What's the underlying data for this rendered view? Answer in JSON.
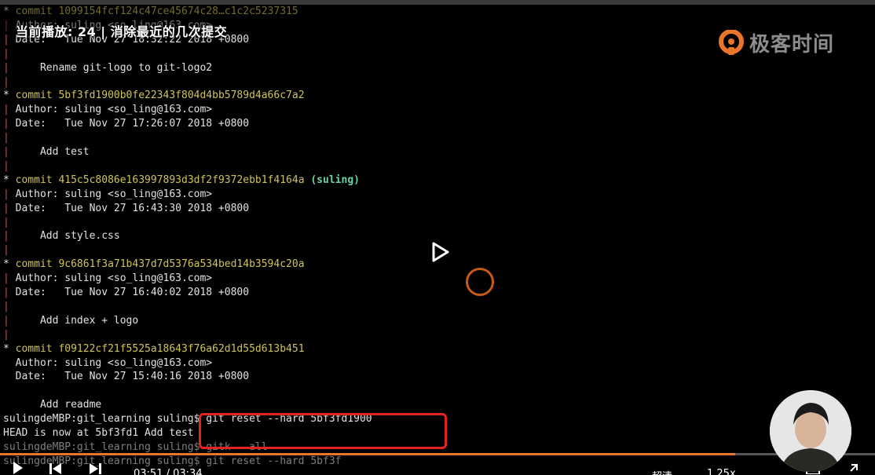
{
  "overlay": {
    "lesson_title": "当前播放: 24 | 消除最近的几次提交"
  },
  "brand": {
    "name": "极客时间",
    "logo_icon": "geektime-logo-icon",
    "logo_color": "#e8752a"
  },
  "terminal": {
    "lines": [
      {
        "graph": "*",
        "prefix": " commit ",
        "hash": "1099154fcf124c47ce45674c28…c1c2c5237315",
        "dim": true
      },
      {
        "graph": "|",
        "text": " Author: suling <so_ling@163.com>",
        "dim": true
      },
      {
        "graph": "|",
        "text": " Date:   Tue Nov 27 18:32:22 2018 +0800"
      },
      {
        "graph": "|",
        "text": ""
      },
      {
        "graph": "|",
        "text": "     Rename git-logo to git-logo2"
      },
      {
        "graph": "|",
        "text": ""
      },
      {
        "graph": "*",
        "prefix": " commit ",
        "hash": "5bf3fd1900b0fe22343f804d4bb5789d4a66c7a2"
      },
      {
        "graph": "|",
        "text": " Author: suling <so_ling@163.com>"
      },
      {
        "graph": "|",
        "text": " Date:   Tue Nov 27 17:26:07 2018 +0800"
      },
      {
        "graph": "|",
        "text": ""
      },
      {
        "graph": "|",
        "text": "     Add test"
      },
      {
        "graph": "|",
        "text": ""
      },
      {
        "graph": "*",
        "prefix": " commit ",
        "hash": "415c5c8086e163997893d3df2f9372ebb1f4164a",
        "branch": "(suling)"
      },
      {
        "graph": "|",
        "text": " Author: suling <so_ling@163.com>"
      },
      {
        "graph": "|",
        "text": " Date:   Tue Nov 27 16:43:30 2018 +0800"
      },
      {
        "graph": "|",
        "text": ""
      },
      {
        "graph": "|",
        "text": "     Add style.css"
      },
      {
        "graph": "|",
        "text": ""
      },
      {
        "graph": "*",
        "prefix": " commit ",
        "hash": "9c6861f3a71b437d7d5376a534bed14b3594c20a"
      },
      {
        "graph": "|",
        "text": " Author: suling <so_ling@163.com>"
      },
      {
        "graph": "|",
        "text": " Date:   Tue Nov 27 16:40:02 2018 +0800"
      },
      {
        "graph": "|",
        "text": ""
      },
      {
        "graph": "|",
        "text": "     Add index + logo"
      },
      {
        "graph": "|",
        "text": ""
      },
      {
        "graph": "*",
        "prefix": " commit ",
        "hash": "f09122cf21f5525a18643f76a62d1d55d613b451"
      },
      {
        "graph": "",
        "text": "  Author: suling <so_ling@163.com>"
      },
      {
        "graph": "",
        "text": "  Date:   Tue Nov 27 15:40:16 2018 +0800"
      },
      {
        "graph": "",
        "text": ""
      },
      {
        "graph": "",
        "text": "      Add readme"
      },
      {
        "graph": "",
        "text": "sulingdeMBP:git_learning suling$ git reset --hard 5bf3fd1900",
        "raw": true
      },
      {
        "graph": "",
        "text": "HEAD is now at 5bf3fd1 Add test",
        "raw": true
      },
      {
        "graph": "",
        "text": "sulingdeMBP:git_learning suling$ gitk --all",
        "raw": true,
        "dim": true
      },
      {
        "graph": "",
        "text": "sulingdeMBP:git_learning suling$ git reset --hard 5bf3f",
        "raw": true,
        "dim": true
      }
    ],
    "colors": {
      "text": "#e2e2e2",
      "graph": "#d04a4a",
      "hash": "#cfc35a",
      "branch": "#6ed2a4"
    }
  },
  "highlight": {
    "color": "#e52222"
  },
  "player": {
    "progress_fraction": 0.84,
    "progress_color": "#e8752a",
    "time_current": "03:51",
    "time_total": "03:34",
    "quality_label": "超清",
    "speed_label": "1.25x",
    "icons": [
      "play-icon",
      "prev-icon",
      "next-icon",
      "settings-icon",
      "fullscreen-icon"
    ]
  },
  "player_controls_hint": {
    "center_play_icon": "play-icon",
    "loading_icon": "loading-spinner-icon"
  }
}
